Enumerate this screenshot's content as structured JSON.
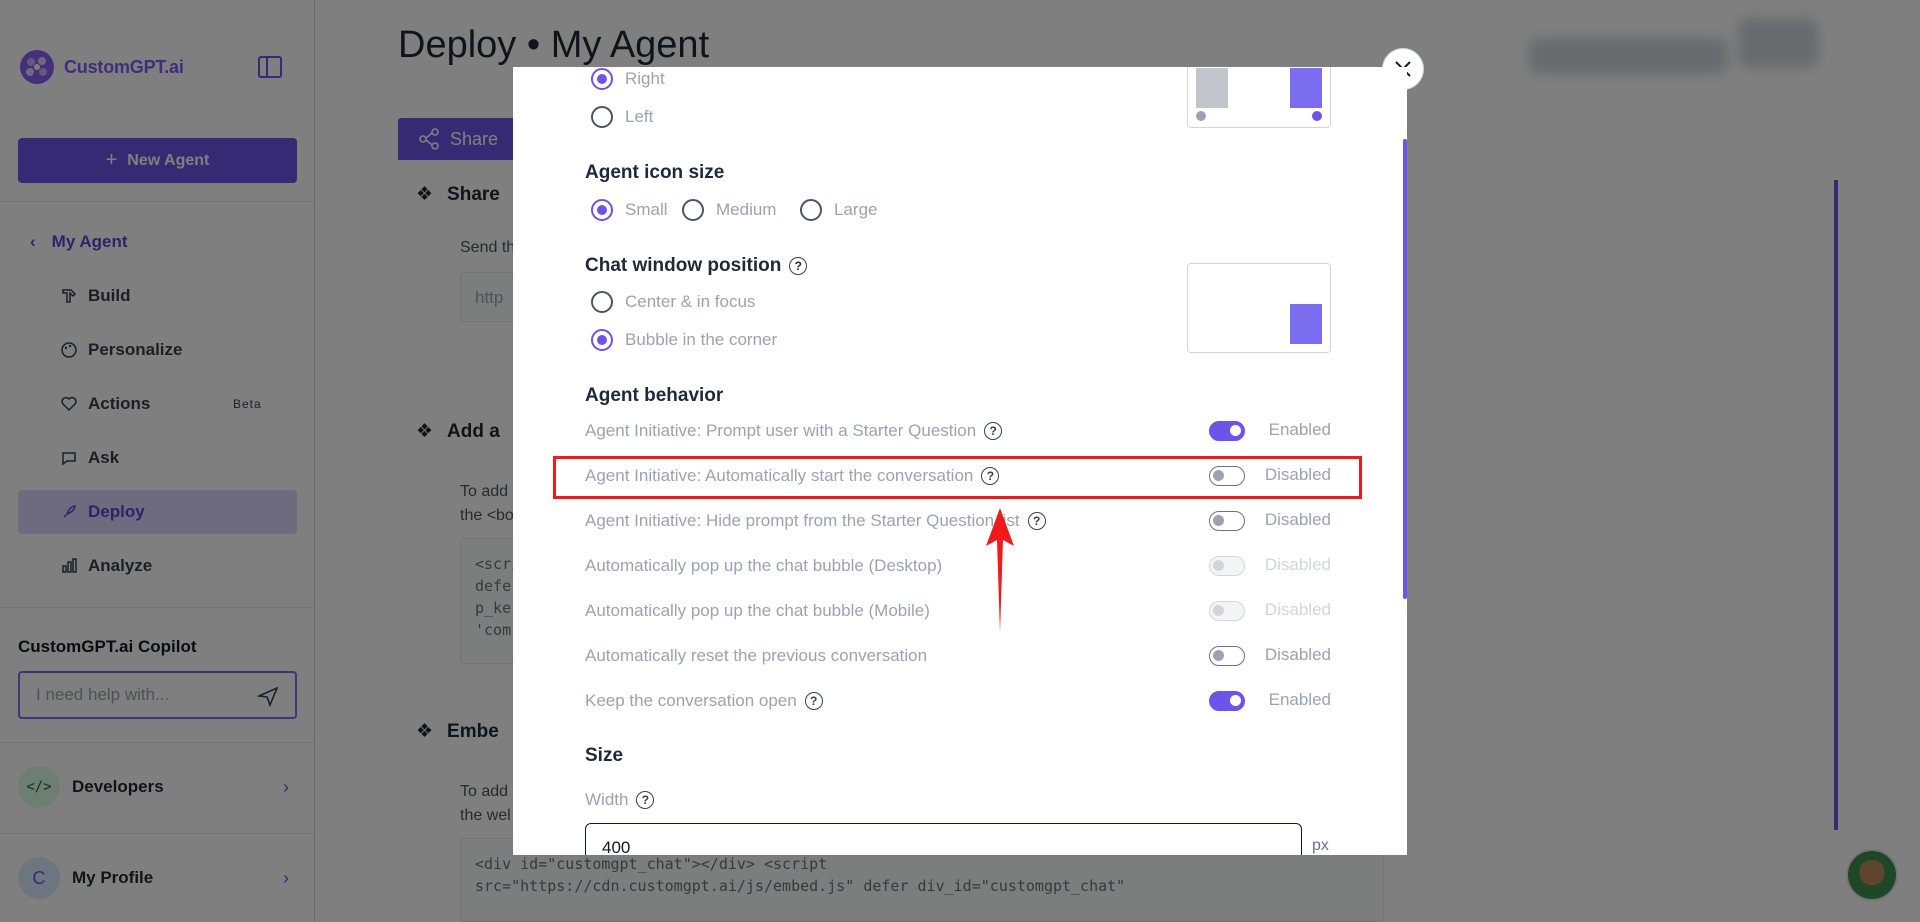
{
  "sidebar": {
    "logo_text": "CustomGPT.ai",
    "new_agent_label": "New Agent",
    "back_label": "My Agent",
    "items": [
      {
        "label": "Build",
        "icon": "build-icon"
      },
      {
        "label": "Personalize",
        "icon": "palette-icon"
      },
      {
        "label": "Actions",
        "icon": "actions-icon",
        "badge": "Beta"
      },
      {
        "label": "Ask",
        "icon": "chat-icon"
      },
      {
        "label": "Deploy",
        "icon": "rocket-icon",
        "active": true
      },
      {
        "label": "Analyze",
        "icon": "chart-icon"
      }
    ],
    "copilot_title": "CustomGPT.ai Copilot",
    "copilot_placeholder": "I need help with...",
    "developers_label": "Developers",
    "developers_avatar": "</>",
    "profile_label": "My Profile",
    "profile_initial": "C"
  },
  "main": {
    "title": "Deploy • My Agent",
    "share_tab": "Share",
    "sections": [
      {
        "title": "Share",
        "sub": "Send th",
        "input": "http"
      },
      {
        "title": "Add a",
        "sub1": "To add",
        "sub2": "the <bo",
        "code": [
          "<scri",
          "defe",
          "p_ke",
          "'com"
        ]
      },
      {
        "title": "Embe",
        "sub1": "To add",
        "sub2": "the wel",
        "code": [
          "<div id=\"customgpt_chat\"></div> <script",
          "src=\"https://cdn.customgpt.ai/js/embed.js\" defer div_id=\"customgpt_chat\""
        ]
      }
    ]
  },
  "modal": {
    "position_options": [
      {
        "label": "Right",
        "selected": true
      },
      {
        "label": "Left",
        "selected": false
      }
    ],
    "icon_size_title": "Agent icon size",
    "icon_sizes": [
      {
        "label": "Small",
        "selected": true
      },
      {
        "label": "Medium",
        "selected": false
      },
      {
        "label": "Large",
        "selected": false
      }
    ],
    "chat_window_title": "Chat window position",
    "chat_window_options": [
      {
        "label": "Center & in focus",
        "selected": false
      },
      {
        "label": "Bubble in the corner",
        "selected": true
      }
    ],
    "behavior_title": "Agent behavior",
    "behaviors": [
      {
        "label": "Agent Initiative: Prompt user with a Starter Question",
        "help": true,
        "state": "Enabled",
        "on": true,
        "dim": false
      },
      {
        "label": "Agent Initiative: Automatically start the conversation",
        "help": true,
        "state": "Disabled",
        "on": false,
        "dim": false
      },
      {
        "label": "Agent Initiative: Hide prompt from the Starter Question list",
        "help": true,
        "state": "Disabled",
        "on": false,
        "dim": false
      },
      {
        "label": "Automatically pop up the chat bubble (Desktop)",
        "help": false,
        "state": "Disabled",
        "on": false,
        "dim": true
      },
      {
        "label": "Automatically pop up the chat bubble (Mobile)",
        "help": false,
        "state": "Disabled",
        "on": false,
        "dim": true
      },
      {
        "label": "Automatically reset the previous conversation",
        "help": false,
        "state": "Disabled",
        "on": false,
        "dim": false
      },
      {
        "label": "Keep the conversation open",
        "help": true,
        "state": "Enabled",
        "on": true,
        "dim": false
      }
    ],
    "size_title": "Size",
    "width_label": "Width",
    "width_value": "400",
    "width_unit": "px"
  },
  "colors": {
    "accent": "#6d54e8",
    "annotation": "#ef1a1a"
  }
}
